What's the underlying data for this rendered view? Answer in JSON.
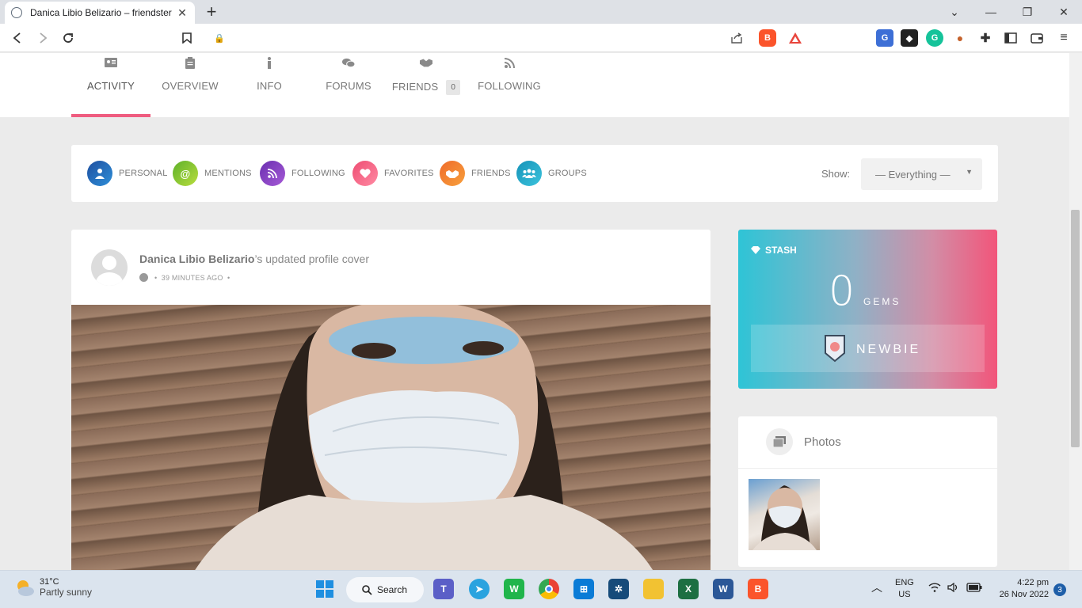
{
  "browser": {
    "tab_title": "Danica Libio Belizario – friendster",
    "address": ""
  },
  "profile_nav": {
    "items": [
      {
        "label": "ACTIVITY",
        "icon": "id-card-icon"
      },
      {
        "label": "OVERVIEW",
        "icon": "clipboard-icon"
      },
      {
        "label": "INFO",
        "icon": "info-icon"
      },
      {
        "label": "FORUMS",
        "icon": "chat-bubbles-icon"
      },
      {
        "label": "FRIENDS",
        "icon": "handshake-icon"
      },
      {
        "label": "FOLLOWING",
        "icon": "rss-icon"
      }
    ],
    "friends_count": "0",
    "active": "ACTIVITY",
    "active_color": "#ef5c7f"
  },
  "filters": {
    "items": [
      {
        "label": "PERSONAL",
        "color": "#1e4fa0"
      },
      {
        "label": "MENTIONS",
        "color": "#7dc42a"
      },
      {
        "label": "FOLLOWING",
        "color": "#8b3fc0"
      },
      {
        "label": "FAVORITES",
        "color": "#f2557a"
      },
      {
        "label": "FRIENDS",
        "color": "#f47c30"
      },
      {
        "label": "GROUPS",
        "color": "#1aa7c9"
      }
    ],
    "show_label": "Show:",
    "show_value": "— Everything —"
  },
  "post": {
    "author": "Danica Libio Belizario",
    "action": "’s updated profile cover",
    "time": "39 MINUTES AGO",
    "separator": "•"
  },
  "stash": {
    "header": "STASH",
    "gems": "0",
    "gems_label": "GEMS",
    "rank": "NEWBIE"
  },
  "photos": {
    "title": "Photos"
  },
  "taskbar": {
    "temperature": "31°C",
    "weather": "Partly sunny",
    "search": "Search",
    "lang1": "ENG",
    "lang2": "US",
    "time": "4:22 pm",
    "date": "26 Nov 2022",
    "notifications": "3"
  }
}
